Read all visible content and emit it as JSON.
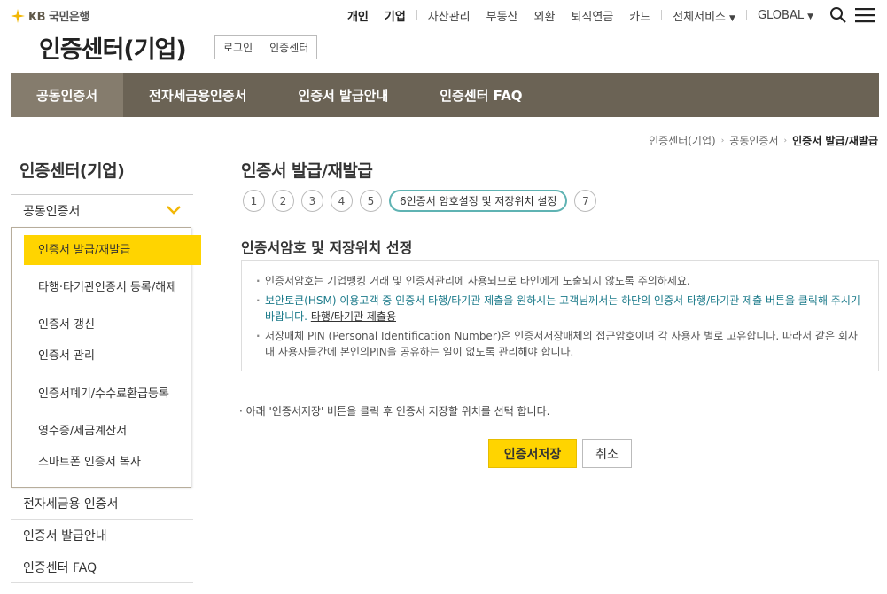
{
  "brand": {
    "logo_kb": "KB",
    "logo_bank": "국민은행"
  },
  "topnav": {
    "items": [
      "개인",
      "기업",
      "자산관리",
      "부동산",
      "외환",
      "퇴직연금",
      "카드",
      "전체서비스",
      "GLOBAL"
    ]
  },
  "header": {
    "title": "인증센터(기업)",
    "tabs": [
      "로그인",
      "인증센터"
    ]
  },
  "gnb": [
    "공동인증서",
    "전자세금용인증서",
    "인증서 발급안내",
    "인증센터 FAQ"
  ],
  "breadcrumb": [
    "인증센터(기업)",
    "공동인증서",
    "인증서 발급/재발급"
  ],
  "lnb": {
    "title": "인증센터(기업)",
    "group": "공동인증서",
    "sub": [
      "인증서 발급/재발급",
      "타행·타기관인증서 등록/해제",
      "인증서 갱신",
      "인증서 관리",
      "인증서폐기/수수료환급등록",
      "영수증/세금계산서",
      "스마트폰 인증서 복사"
    ],
    "rest": [
      "전자세금용 인증서",
      "인증서 발급안내",
      "인증센터 FAQ"
    ]
  },
  "main": {
    "title": "인증서 발급/재발급",
    "steps": [
      "1",
      "2",
      "3",
      "4",
      "5",
      "6인증서 암호설정 및 저장위치 설정",
      "7"
    ],
    "section_title": "인증서암호 및 저장위치 선정",
    "notice": {
      "line1": "인증서암호는 기업뱅킹 거래 및 인증서관리에 사용되므로 타인에게 노출되지 않도록 주의하세요.",
      "line2": "보안토큰(HSM) 이용고객 중 인증서 타행/타기관 제출을 원하시는 고객님께서는 하단의 인증서 타행/타기관 제출 버튼을 클릭해 주시기 바랍니다.",
      "line2_link": "타행/타기관 제출용",
      "line3": "저장매체 PIN (Personal Identification Number)은 인증서저장매체의 접근암호이며 각 사용자 별로 고유합니다. 따라서 같은 회사 내 사용자들간에 본인의PIN을 공유하는 일이 없도록 관리해야 합니다."
    },
    "guide": "· 아래 '인증서저장' 버튼을 클릭 후 인증서 저장할 위치를 선택 합니다.",
    "save_button": "인증서저장",
    "cancel_button": "취소"
  },
  "colors": {
    "gnb": "#6b6355",
    "accent": "#ffd400",
    "step_active": "#5fb3b3"
  }
}
